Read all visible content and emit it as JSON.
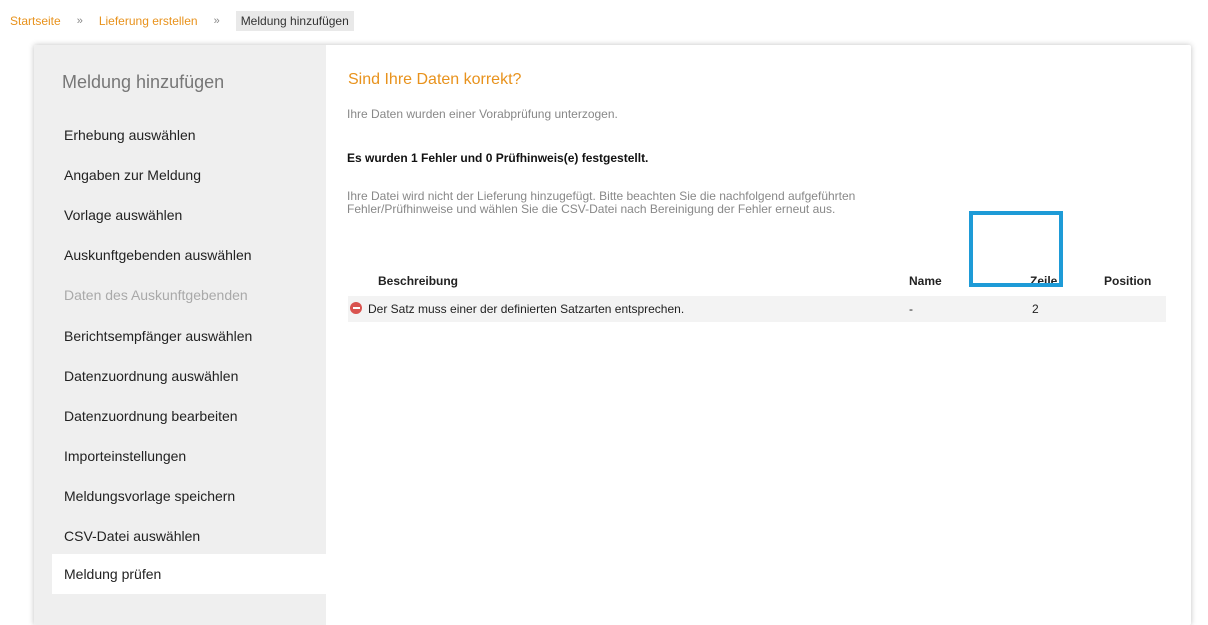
{
  "breadcrumb": {
    "items": [
      "Startseite",
      "Lieferung erstellen"
    ],
    "separator": "»",
    "current": "Meldung hinzufügen"
  },
  "sidebar": {
    "title": "Meldung hinzufügen",
    "steps": [
      {
        "label": "Erhebung auswählen",
        "state": "normal"
      },
      {
        "label": "Angaben zur Meldung",
        "state": "normal"
      },
      {
        "label": "Vorlage auswählen",
        "state": "normal"
      },
      {
        "label": "Auskunftgebenden auswählen",
        "state": "normal"
      },
      {
        "label": "Daten des Auskunftgebenden",
        "state": "disabled"
      },
      {
        "label": "Berichtsempfänger auswählen",
        "state": "normal"
      },
      {
        "label": "Datenzuordnung auswählen",
        "state": "normal"
      },
      {
        "label": "Datenzuordnung bearbeiten",
        "state": "normal"
      },
      {
        "label": "Importeinstellungen",
        "state": "normal"
      },
      {
        "label": "Meldungsvorlage speichern",
        "state": "normal"
      },
      {
        "label": "CSV-Datei auswählen",
        "state": "normal"
      },
      {
        "label": "Meldung prüfen",
        "state": "active"
      }
    ]
  },
  "main": {
    "title": "Sind Ihre Daten korrekt?",
    "info": "Ihre Daten wurden einer Vorabprüfung unterzogen.",
    "summary": "Es wurden 1 Fehler und 0 Prüfhinweis(e) festgestellt.",
    "warning": "Ihre Datei wird nicht der Lieferung hinzugefügt. Bitte beachten Sie die nachfolgend aufgeführten Fehler/Prüfhinweise und wählen Sie die CSV-Datei nach Bereinigung der Fehler erneut aus.",
    "table": {
      "headers": {
        "description": "Beschreibung",
        "name": "Name",
        "line": "Zeile",
        "position": "Position"
      },
      "rows": [
        {
          "icon": "error-icon",
          "description": "Der Satz muss einer der definierten Satzarten entsprechen.",
          "name": "-",
          "line": "2",
          "position": ""
        }
      ]
    }
  },
  "colors": {
    "accent": "#e8921c",
    "error": "#d9534f",
    "highlight": "#1e9bd7",
    "sidebar_bg": "#efefef"
  }
}
